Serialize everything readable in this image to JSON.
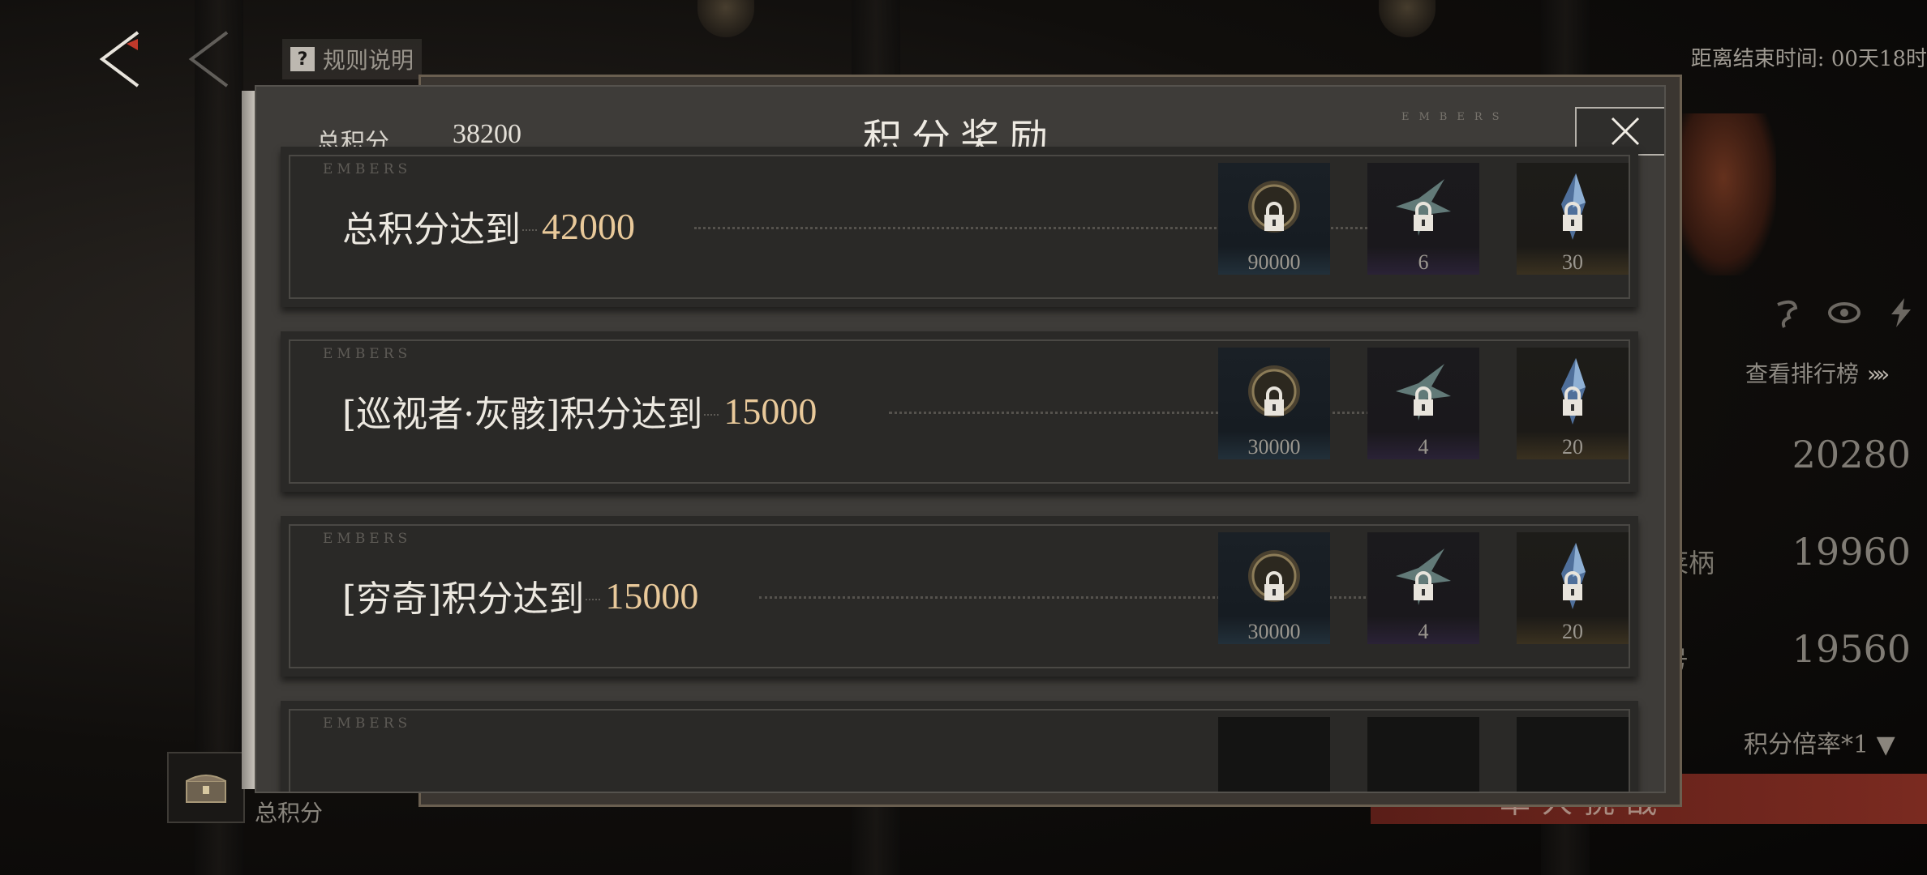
{
  "top_bar": {
    "rules_label": "规则说明",
    "end_time": "距离结束时间: 00天18时"
  },
  "side_panel": {
    "rank_link": "查看排行榜",
    "rank_arrows": "»»",
    "rankings": [
      {
        "name": "",
        "score": "20280"
      },
      {
        "name": "莱柄",
        "score": "19960"
      },
      {
        "name": "号",
        "score": "19560"
      }
    ],
    "multiplier": "积分倍率*1 ▼",
    "challenge_label": "单人挑战",
    "chest_label": "总积分"
  },
  "modal": {
    "title": "积分奖励",
    "total_label": "总积分",
    "total_value": "38200",
    "embers_watermark": "EMBERS",
    "cards": [
      {
        "label": "总积分达到",
        "target": "42000",
        "rewards": [
          {
            "icon": "coin-icon",
            "qty": "90000"
          },
          {
            "icon": "star-shard-icon",
            "qty": "6"
          },
          {
            "icon": "crystal-icon",
            "qty": "30"
          }
        ]
      },
      {
        "label": "[巡视者·灰骸]积分达到",
        "target": "15000",
        "rewards": [
          {
            "icon": "coin-icon",
            "qty": "30000"
          },
          {
            "icon": "star-shard-icon",
            "qty": "4"
          },
          {
            "icon": "crystal-icon",
            "qty": "20"
          }
        ]
      },
      {
        "label": "[穷奇]积分达到",
        "target": "15000",
        "rewards": [
          {
            "icon": "coin-icon",
            "qty": "30000"
          },
          {
            "icon": "star-shard-icon",
            "qty": "4"
          },
          {
            "icon": "crystal-icon",
            "qty": "20"
          }
        ]
      },
      {
        "label": "",
        "target": "",
        "rewards": []
      }
    ]
  },
  "colors": {
    "target_gold": "#e9c99a",
    "modal_bg": "#3e3c39",
    "card_bg": "#2a2927",
    "challenge_red": "#7a2a20"
  }
}
